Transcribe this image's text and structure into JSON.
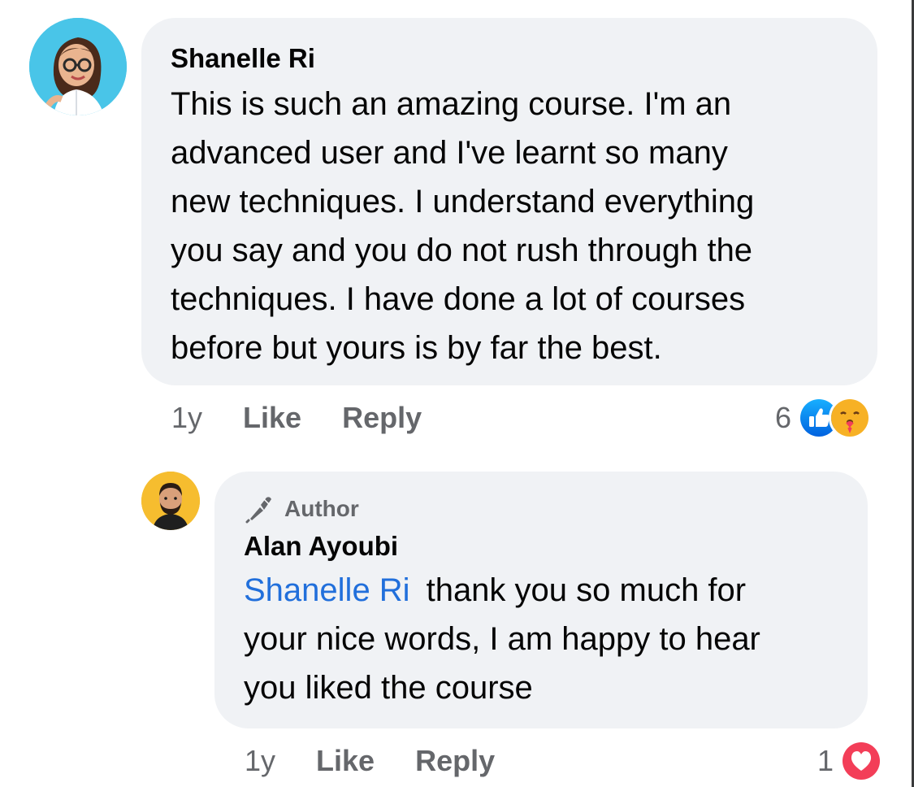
{
  "comments": [
    {
      "author": "Shanelle Ri",
      "text_lines": [
        "This is such an amazing course. I'm an",
        "advanced user and I've learnt so many",
        "new techniques. I understand everything",
        "you say and you do not rush through the",
        "techniques. I have done a lot of courses",
        "before but yours is by far the best."
      ],
      "time": "1y",
      "like_label": "Like",
      "reply_label": "Reply",
      "reaction_count": "6",
      "reactions": [
        "like-icon",
        "care-icon"
      ]
    }
  ],
  "reply": {
    "badge": "Author",
    "badge_icon": "microphone-icon",
    "author": "Alan Ayoubi",
    "mention": "Shanelle Ri",
    "text_first": "thank you so much for",
    "text_lines": [
      "your nice words, I am happy to hear",
      "you liked the course"
    ],
    "time": "1y",
    "like_label": "Like",
    "reply_label": "Reply",
    "reaction_count": "1",
    "reactions": [
      "love-icon"
    ]
  },
  "colors": {
    "bubble": "#f0f2f5",
    "meta_text": "#65676b",
    "mention": "#216fdb",
    "like_blue": "#1877f2",
    "love_red": "#f33e58"
  }
}
